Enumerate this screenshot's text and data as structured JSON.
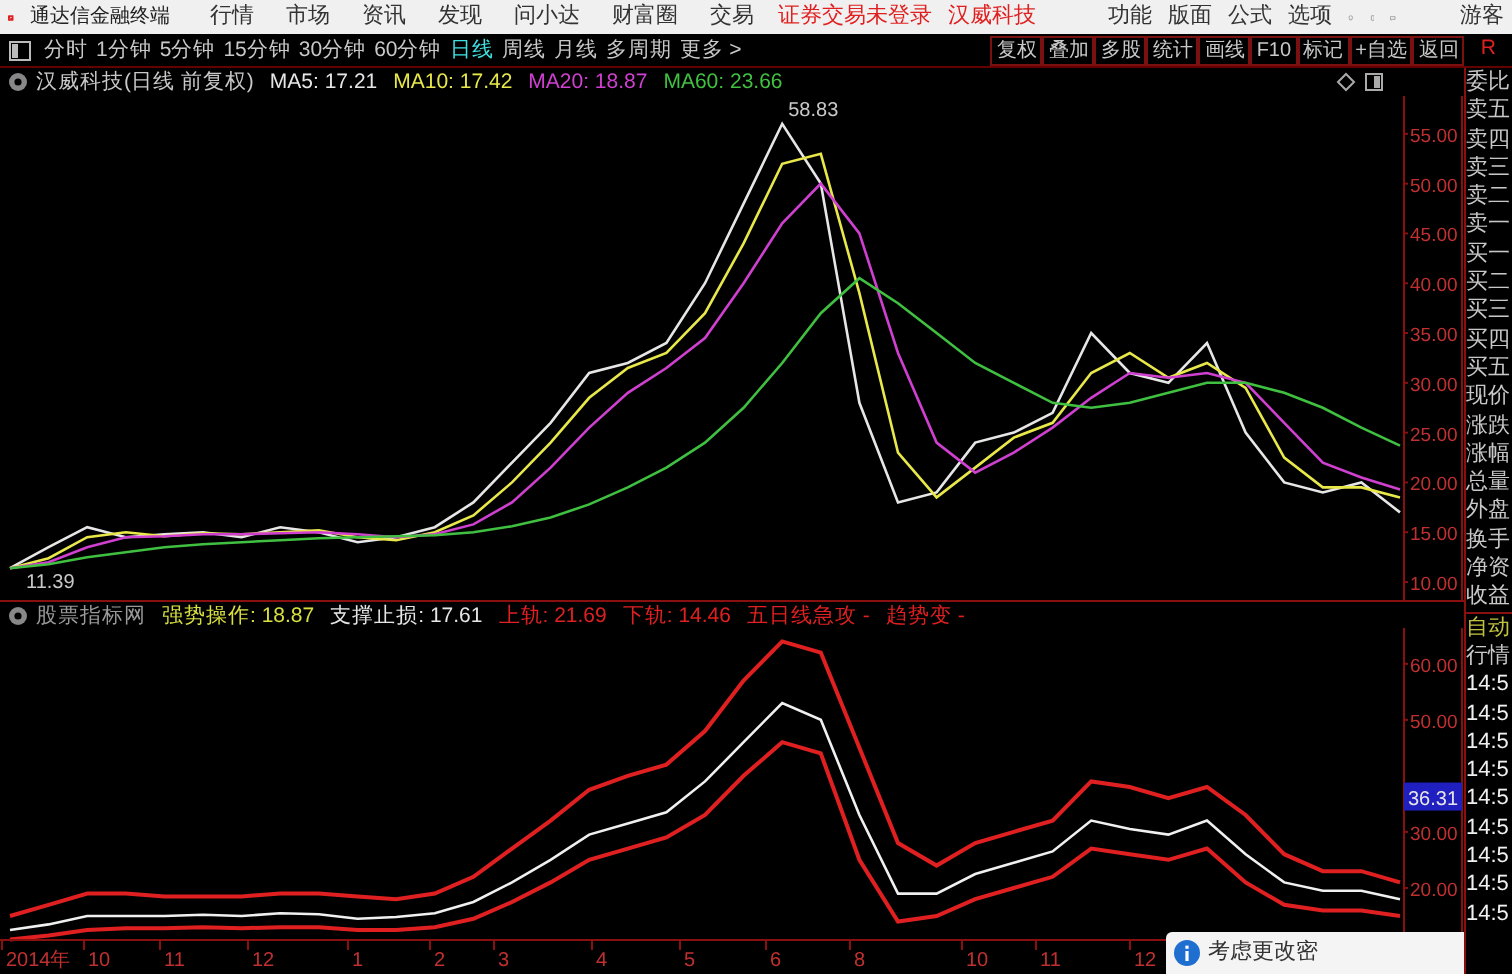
{
  "app_bar": {
    "title": "通达信金融终端",
    "menu": [
      "行情",
      "市场",
      "资讯",
      "发现",
      "问小达",
      "财富圈",
      "交易"
    ],
    "notice": [
      "证券交易未登录",
      "汉威科技"
    ],
    "tools": [
      "功能",
      "版面",
      "公式",
      "选项"
    ],
    "user": "游客"
  },
  "toolbar": {
    "periods": [
      {
        "label": "分时",
        "selected": false
      },
      {
        "label": "1分钟",
        "selected": false
      },
      {
        "label": "5分钟",
        "selected": false
      },
      {
        "label": "15分钟",
        "selected": false
      },
      {
        "label": "30分钟",
        "selected": false
      },
      {
        "label": "60分钟",
        "selected": false
      },
      {
        "label": "日线",
        "selected": true
      },
      {
        "label": "周线",
        "selected": false
      },
      {
        "label": "月线",
        "selected": false
      },
      {
        "label": "多周期",
        "selected": false
      },
      {
        "label": "更多 >",
        "selected": false
      }
    ],
    "actions": [
      "复权",
      "叠加",
      "多股",
      "统计",
      "画线",
      "F10",
      "标记",
      "+自选",
      "返回"
    ],
    "corner": "R"
  },
  "main_legend": {
    "title": "汉威科技(日线 前复权)",
    "readings": [
      ": 17.21",
      ": 17.42",
      ": 18.87",
      ": 23.66"
    ]
  },
  "main_chart": {
    "price_labels": [
      "58.83",
      "11.39"
    ],
    "chart_data": {
      "type": "line",
      "ylim": [
        8.2,
        58.8
      ],
      "yticks": [
        {
          "value": 10,
          "label": "10.00"
        },
        {
          "value": 15,
          "label": "15.00"
        },
        {
          "value": 20,
          "label": "20.00"
        },
        {
          "value": 25,
          "label": "25.00"
        },
        {
          "value": 30,
          "label": "30.00"
        },
        {
          "value": 35,
          "label": "35.00"
        },
        {
          "value": 40,
          "label": "40.00"
        },
        {
          "value": 45,
          "label": "45.00"
        },
        {
          "value": 50,
          "label": "50.00"
        },
        {
          "value": 55,
          "label": "55.00"
        }
      ],
      "series": [
        {
          "name": "MA5",
          "color": "#e6e6e6",
          "values": [
            11.4,
            13.5,
            15.5,
            14.5,
            14.8,
            15,
            14.5,
            15.5,
            15,
            14,
            14.5,
            15.5,
            18,
            22,
            26,
            31,
            32,
            34,
            40,
            48,
            56,
            50,
            28,
            18,
            19,
            24,
            25,
            27,
            35,
            31,
            30,
            34,
            25,
            20,
            19,
            20,
            17
          ]
        },
        {
          "name": "MA10",
          "color": "#e8e84a",
          "values": [
            11.4,
            12.4,
            14.5,
            15,
            14.6,
            14.9,
            14.8,
            15,
            15.2,
            14.5,
            14.2,
            15,
            16.7,
            20,
            24,
            28.5,
            31.5,
            33,
            37,
            44,
            52,
            53,
            39,
            23,
            18.5,
            21.5,
            24.5,
            26,
            31,
            33,
            30.5,
            32,
            29.5,
            22.5,
            19.5,
            19.5,
            18.5
          ]
        },
        {
          "name": "MA20",
          "color": "#d040d0",
          "values": [
            11.4,
            12,
            13.5,
            14.5,
            14.6,
            14.8,
            14.8,
            14.9,
            15,
            14.8,
            14.5,
            14.8,
            15.8,
            18,
            21.5,
            25.5,
            29,
            31.5,
            34.5,
            40,
            46,
            50,
            45,
            33,
            24,
            21,
            23,
            25.5,
            28.5,
            31,
            30.5,
            31,
            30,
            26,
            22,
            20.5,
            19.3
          ]
        },
        {
          "name": "MA60",
          "color": "#40c040",
          "values": [
            11.4,
            11.8,
            12.5,
            13,
            13.5,
            13.8,
            14,
            14.2,
            14.4,
            14.5,
            14.6,
            14.7,
            15,
            15.6,
            16.5,
            17.8,
            19.5,
            21.5,
            24,
            27.5,
            32,
            37,
            40.5,
            38,
            35,
            32,
            30,
            28,
            27.5,
            28,
            29,
            30,
            30,
            29,
            27.5,
            25.5,
            23.7
          ]
        }
      ]
    }
  },
  "sub_legend": {
    "title": "股票指标网",
    "items": [
      {
        "kind": "series",
        "reading": ": 18.87",
        "color": "#d8e040"
      },
      {
        "kind": "text",
        "label": "支撑止损: 17.61",
        "color": "#e6e6e6"
      },
      {
        "kind": "series",
        "reading": ": 21.69",
        "color": "#e02020"
      },
      {
        "kind": "series",
        "reading": ": 14.46",
        "color": "#e02020"
      },
      {
        "kind": "text",
        "label": "五日线急攻 -",
        "color": "#e02020"
      },
      {
        "kind": "text",
        "label": "趋势变 -",
        "color": "#e02020"
      }
    ]
  },
  "sub_chart": {
    "current_value": "36.31",
    "axis_labels": [
      "2014年",
      "10",
      "11",
      "12",
      "1",
      "2",
      "3",
      "4",
      "5",
      "6",
      "8",
      "10",
      "11",
      "12"
    ],
    "chart_data": {
      "type": "line",
      "ylim": [
        10.7,
        66.4
      ],
      "yticks": [
        {
          "value": 20,
          "label": "20.00"
        },
        {
          "value": 30,
          "label": "30.00"
        },
        {
          "value": 50,
          "label": "50.00"
        },
        {
          "value": 60,
          "label": "60.00"
        }
      ],
      "series": [
        {
          "name": "强势操作",
          "color": "#f0f0f0",
          "values": [
            12.5,
            13.5,
            15,
            15,
            15,
            15.2,
            15,
            15.5,
            15.3,
            14.5,
            14.8,
            15.5,
            17.5,
            21,
            25,
            29.5,
            31.5,
            33.5,
            39,
            46,
            53,
            50,
            33,
            19,
            19,
            22.5,
            24.5,
            26.5,
            32,
            30.5,
            29.5,
            32,
            26,
            21,
            19.5,
            19.5,
            18
          ]
        },
        {
          "name": "上轨",
          "color": "#e02020",
          "values": [
            15,
            17,
            19,
            19,
            18.5,
            18.5,
            18.5,
            19,
            19,
            18.5,
            18,
            19,
            22,
            27,
            32,
            37.5,
            40,
            42,
            48,
            57,
            64,
            62,
            45,
            28,
            24,
            28,
            30,
            32,
            39,
            38,
            36,
            38,
            33,
            26,
            23,
            23,
            21
          ]
        },
        {
          "name": "下轨",
          "color": "#e02020",
          "values": [
            10.8,
            11.5,
            12.5,
            12.8,
            12.8,
            13,
            12.8,
            13,
            13,
            12.5,
            12.5,
            13,
            14.5,
            17.5,
            21,
            25,
            27,
            29,
            33,
            40,
            46,
            44,
            25,
            14,
            15,
            18,
            20,
            22,
            27,
            26,
            25,
            27,
            21,
            17,
            16,
            16,
            15
          ]
        }
      ]
    }
  },
  "side_panel": {
    "labels": [
      "委比",
      "卖五",
      "卖四",
      "卖三",
      "卖二",
      "卖一",
      "买一",
      "买二",
      "买三",
      "买四",
      "买五",
      "现价",
      "涨跌",
      "涨幅",
      "总量",
      "外盘",
      "换手",
      "净资",
      "收益"
    ],
    "status": "自动",
    "section": "行情",
    "times": [
      "14:5",
      "14:5",
      "14:5",
      "14:5",
      "14:5",
      "14:5",
      "14:5",
      "14:5",
      "14:5"
    ]
  },
  "notice_popup": {
    "text": "考虑更改密"
  }
}
